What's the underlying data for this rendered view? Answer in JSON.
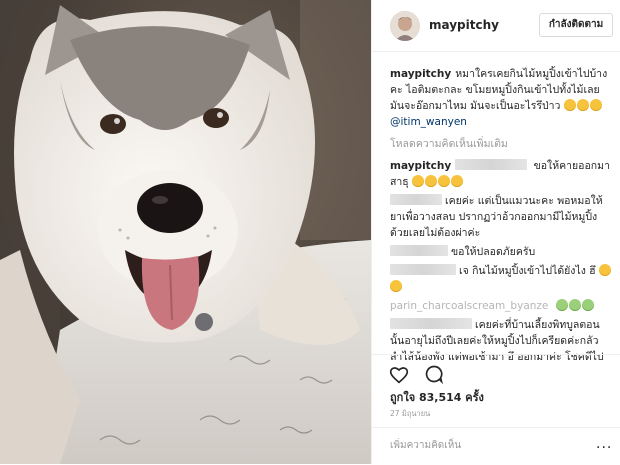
{
  "post": {
    "image_alt": "husky-dog-photo",
    "owner": {
      "username": "maypitchy",
      "follow_label": "กำลังติดตาม"
    },
    "comments": [
      {
        "username": "maypitchy",
        "text": "หมาใครเคยกินไม้หมูปิ้งเข้าไปบ้างคะ ไอติมตะกละ ขโมยหมูปิ้งกินเข้าไปทั้งไม้เลย มันจะอ๊อกมาไหม มันจะเป็นอะไรรึป่าว",
        "mention": "@itim_wanyen"
      }
    ],
    "load_more_label": "โหลดความคิดเห็นเพิ่มเติม",
    "replies": [
      {
        "username": "maypitchy",
        "text": "ขอให้คายออกมาสาธุ"
      },
      {
        "username": "",
        "text": "เคยค่ะ แต่เป็นแมวนะคะ พอหมอให้ยาเพื่อวางสลบ ปรากฏว่าอ้วกออกมามีไม้หมูปิ้งด้วยเลยไม่ต้องผ่าค่ะ"
      },
      {
        "username": "",
        "text": "ขอให้ปลอดภัยครับ"
      },
      {
        "username": "",
        "text": "เจ กินไม้หมูปิ้งเข้าไปได้ยังไง ฮึ"
      },
      {
        "username": "parin_charcoalscream_byanze",
        "text": ""
      },
      {
        "username": "",
        "text": "เคยค่ะที่บ้านเลี้ยงพิทบูลตอนนั้นอายุไม่ถึงปีเลยค่ะให้หมูปิ้งไปก็เครียดค่ะกลัวลำไส้น้องพัง แต่พอเช้ามา อึ ออกมาค่ะ โชคดีไป"
      }
    ],
    "likes_label": "ถูกใจ",
    "likes_count": "83,514",
    "likes_unit": "ครั้ง",
    "date": "27 มิถุนายน",
    "add_comment_placeholder": "เพิ่มความคิดเห็น",
    "more_label": "...",
    "icons": [
      "heart-icon",
      "comment-icon",
      "more-options-icon"
    ],
    "colors": {
      "text": "#262626",
      "muted": "#999999",
      "link": "#003569",
      "border": "#efefef"
    }
  }
}
